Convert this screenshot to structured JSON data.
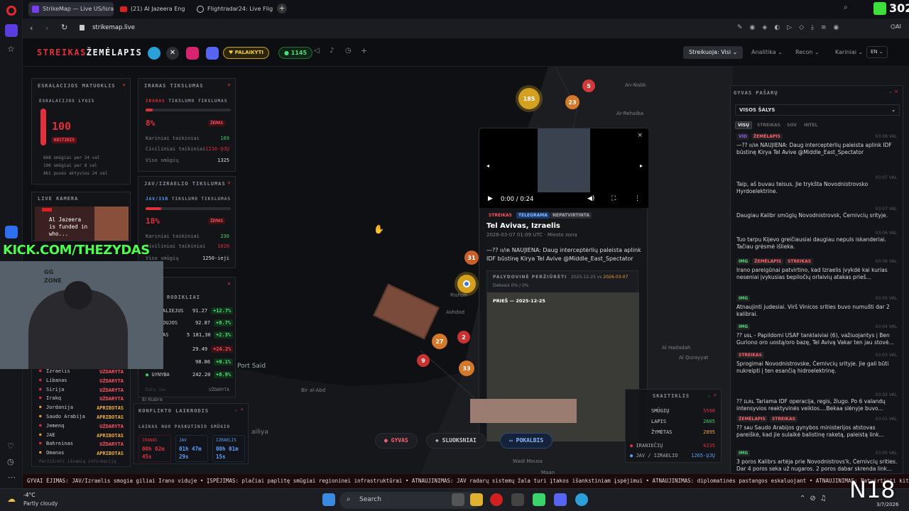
{
  "browser": {
    "tabs": [
      {
        "label": "StrikeMap — Live US/Israe"
      },
      {
        "label": "(21) Al Jazeera Eng"
      },
      {
        "label": "Flightradar24: Live Flight T"
      }
    ],
    "url": "strikemap.live",
    "overlay_count": "302"
  },
  "app": {
    "logo_a": "STREIKAS",
    "logo_b": "ŽEMĖLAPIS",
    "support_label": "PALAIKYTI",
    "online_count": "1145",
    "nav": {
      "filter": "Streikuoja: Visi",
      "analytics": "Analitika",
      "recon": "Recon",
      "military": "Kariniai",
      "lang": "EN"
    }
  },
  "escalation": {
    "title": "ESKALACIJOS MATUOKLIS",
    "level_label": "ESKALACIJOS LYGIS",
    "value": "100",
    "status": "KRITINIS",
    "stats": [
      "668 smūgiai per 24 val",
      "196 smūgiai per 8 val",
      "Abi pusės aktyvios 24 val"
    ],
    "level_fraction": 1.0
  },
  "iran_accuracy": {
    "title": "IRANAS TIKSLUMAS",
    "sub_a": "IRANAS",
    "sub_b": "TIKSLUMO TIKSLUMAS",
    "pct": "8%",
    "status": "ŽEMAS",
    "fill": 0.08,
    "rows": [
      {
        "k": "Kariniai taikiniai",
        "v": "109"
      },
      {
        "k": "Civiliniai taikiniai",
        "v": "1216-ŲJŲ"
      },
      {
        "k": "Viso smūgių",
        "v": "1325"
      }
    ]
  },
  "us_accuracy": {
    "title": "JAV/IZRAELIO TIKSLUMAS",
    "sub_a": "JAV/ISR",
    "sub_b": "TIKSLUMO TIKSLUMAS",
    "pct": "18%",
    "status": "ŽEMAS",
    "fill": 0.18,
    "rows": [
      {
        "k": "Kariniai taikiniai",
        "v": "230"
      },
      {
        "k": "Civiliniai taikiniai",
        "v": "1020"
      },
      {
        "k": "Viso smūgių",
        "v": "1250-ieji"
      }
    ]
  },
  "live_camera": {
    "title": "LIVE KAMERA",
    "caption": "Al Jazeera is funded in who..."
  },
  "stream_overlay": {
    "url_text": "KICK.COM/THEZYDAS",
    "logo_text": "GG ZONE"
  },
  "indicators": {
    "title": "RODIKLIAI",
    "rows": [
      {
        "name": "ALIEJUS",
        "val": "91.27",
        "chg": "+12.7%"
      },
      {
        "name": "DUJOS",
        "val": "92.87",
        "chg": "+8.7%"
      },
      {
        "name": "AS",
        "val": "5 181,30",
        "chg": "+2.3%"
      },
      {
        "name": "",
        "val": "29.49",
        "chg": "+24.2%"
      },
      {
        "name": "",
        "val": "98.86",
        "chg": "+0.1%"
      },
      {
        "name": "GYNYBA",
        "val": "242.20",
        "chg": "+8.9%"
      }
    ],
    "footer_a": "Data Jav",
    "footer_b": "UŽDARYTA"
  },
  "airspace": {
    "rows": [
      {
        "c": "Izraelis",
        "s": "UŽDARYTA"
      },
      {
        "c": "Libanas",
        "s": "UŽDARYTA"
      },
      {
        "c": "Sirija",
        "s": "UŽDARYTA"
      },
      {
        "c": "Irakq",
        "s": "UŽDARYTA"
      },
      {
        "c": "Jordanija",
        "s": "APRIBOTAS"
      },
      {
        "c": "Saudo Arabija",
        "s": "APRIBOTAS"
      },
      {
        "c": "Jemenq",
        "s": "UŽDARYTA"
      },
      {
        "c": "JAE",
        "s": "APRIBOTAS"
      },
      {
        "c": "Bahreinas",
        "s": "UŽDARYTA"
      },
      {
        "c": "Omanas",
        "s": "APRIBOTAS"
      }
    ],
    "footer": "Peržiūrėti išsamią informaciją"
  },
  "conflict_clock": {
    "title": "KONFLIKTO LAIKRODIS",
    "sub": "LAIKAS NUO PASKUTINIO SMŪGIO",
    "cells": [
      {
        "k": "IRANAS",
        "v1": "00h 02m",
        "v2": "45s"
      },
      {
        "k": "JAV",
        "v1": "01h 47m",
        "v2": "29s"
      },
      {
        "k": "IZRAELIS",
        "v1": "00h 01m",
        "v2": "15s"
      }
    ]
  },
  "counts": {
    "title": "SKAITIKLIS",
    "rows": [
      {
        "k": "SMŪGIŲ",
        "v": "5590"
      },
      {
        "k": "LAPIS",
        "v": "2605"
      },
      {
        "k": "ŽYMĖTAS",
        "v": "2895"
      }
    ],
    "foot": [
      {
        "k": "IRANIEČIŲ",
        "v": "4235"
      },
      {
        "k": "JAV / IZRAELIO",
        "v": "1265-ŲJŲ"
      }
    ]
  },
  "map_labels": {
    "port_said": "Port Said",
    "bir": "Bir al-Abd",
    "el_kubra": "El Kubra",
    "ailiya": "ailiya",
    "ashdod": "Ashdod",
    "rishon": "Rishon",
    "an_nabk": "An-Nabk",
    "rehaiba": "Ar-Rehaiba",
    "hadadah": "Al Hadadah",
    "quraiyat": "Al Qurayyat",
    "wadi": "Wadi Mousa",
    "maan": "Maan"
  },
  "clusters": [
    "185",
    "23",
    "5",
    "31",
    "27",
    "2",
    "9",
    "33"
  ],
  "popup": {
    "time": "0:00 / 0:24",
    "tag1": "STREIKAS",
    "tag2": "TELEGRAMA",
    "tag3": "NEPATVIRTINTA",
    "title": "Tel Avivas, Izraelis",
    "meta": "2026-03-07 01:09 UTC",
    "meta2": "Miesto zona",
    "text": "—?? ıı/ıʀ NAUJIENA: Daug interceptėrlių paleista aplink IDF būstinę Kirya Tel Avive @Middle_East_Spectator",
    "compare_label": "PALYDOVINĖ PERŽIŪRĖTI",
    "date_a": "2025-12-25",
    "vs": "vs",
    "date_b": "2026-03-07",
    "diff": "Debesis 0% / 0%",
    "before": "PRIEŠ — 2025-12-25"
  },
  "feed": {
    "title": "GYVAS PAŠARŲ",
    "scope": "VISOS ŠALYS",
    "filters": [
      "VISŲ",
      "STREIKAS",
      "SOV",
      "INTEL"
    ],
    "items": [
      {
        "tags": "VID ŽEMĖLAPIS",
        "time": "03:08 VAL",
        "text": "—?? ıı/ıʀ NAUJIENA: Daug interceptėrlių paleista aplink IDF būstinę Kirya Tel Avive @Middle_East_Spectator"
      },
      {
        "tags": "",
        "time": "03:07 VAL",
        "text": "Taip, aš buvau teisus. Jie trykšta Novodnistrovsko Hyrdoelektrine."
      },
      {
        "tags": "",
        "time": "03:07 VAL",
        "text": "Daugiau Kalibr smūgių Novodnistrovsk, Černivcių srityje."
      },
      {
        "tags": "",
        "time": "03:06 VAL",
        "text": "Tuo tarpu Kijevo greičiausiai daugiau nepuls iskanderiai. Tačiau grėsmė išlieka."
      },
      {
        "tags": "IMG ŽEMĖLAPIS STREIKAS",
        "time": "03:06 VAL",
        "text": "Irano pareigūnai patvirtino, kad Izraelis įvykdė kai kurias neseniai įvykusias bepiločių orlaivių atakas prieš..."
      },
      {
        "tags": "IMG",
        "time": "03:05 VAL",
        "text": "Atnaujinti judesiai. Virš Vinicos srities buvo numušti dar 2 kalibrai."
      },
      {
        "tags": "IMG",
        "time": "03:04 VAL",
        "text": "?? ᴜsʟ - Papildomi USAF tanklaiviai (6), važiuojantys į Ben Guriono oro uostą/oro bazę, Tel Avivą Vakar ten jau stovė..."
      },
      {
        "tags": "STREIKAS",
        "time": "03:03 VAL",
        "text": "Sprogimai Novodnistrovske, Černivcių srityje. Jie gali būti nukreipti į ten esančią hidroelektrinę."
      },
      {
        "tags": "",
        "time": "03:02 VAL",
        "text": "?? ɪʟʀʟ Tariama IDF operacija, regis, žlugo. Po 6 valandų intensyvios reaktyvinės veiklos....Bekaa slėnyje buvo..."
      },
      {
        "tags": "ŽEMĖLAPIS STREIKAS",
        "time": "03:01 VAL",
        "text": "?? sᴀᴜ Saudo Arabijos gynybos ministerijos atstovas pareiškė, kad jie sulaikė balistinę raketą, paleistą link..."
      },
      {
        "tags": "IMG",
        "time": "03:00 VAL",
        "text": "3 poros Kalibrs artėja prie Novodnistrovs'k, Černivcių srities. Dar 4 poros seka už nugaros. 2 poros dabar skrenda link..."
      }
    ]
  },
  "bottom_tabs": {
    "live": "GYVAS",
    "layers": "SLUOKSNIAI",
    "chat": "POKALBIS"
  },
  "ticker": "GYVAI  ĖJIMAS: JAV/Izraelis smogia giliai Irano viduje • ĮSPĖJIMAS: plačiai paplitę smūgiai regioninei infrastruktūrai • ATNAUJINIMAS: JAV radarų sistemų žala turi įtakos išankstiniam įspėjimui • ATNAUJINIMAS: diplomatinės pastangos eskaluojant • ATNAUJINIMAS: Patvirtinti kiti",
  "taskbar": {
    "temp": "-4°C",
    "weather": "Partly cloudy",
    "search": "Search",
    "date": "3/7/2026",
    "n18": "N18"
  }
}
